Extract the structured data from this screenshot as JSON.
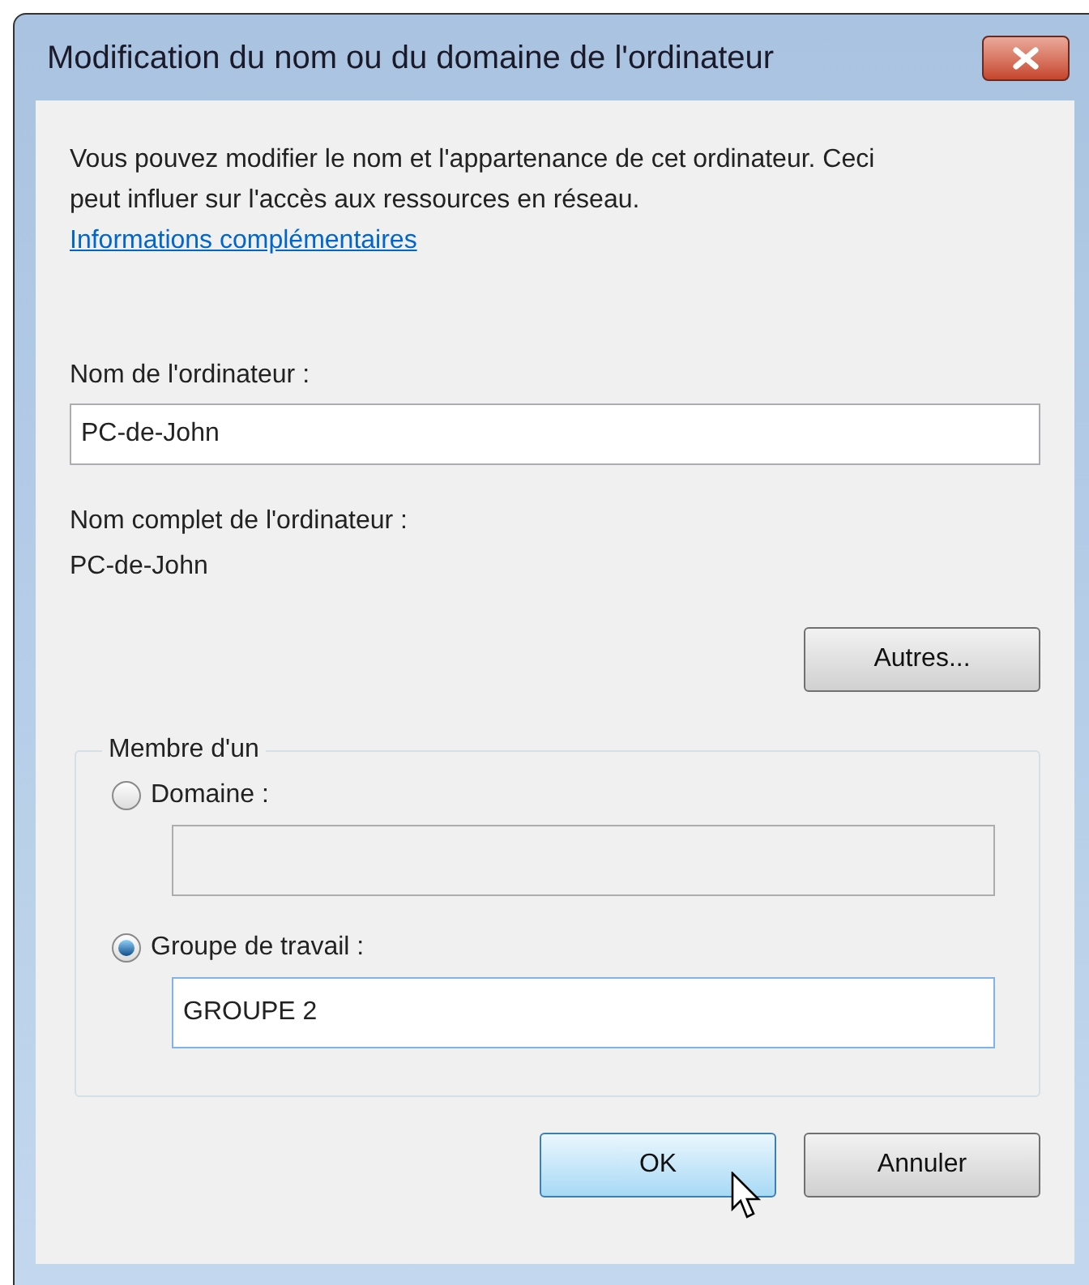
{
  "window": {
    "title": "Modification du nom ou du domaine de l'ordinateur"
  },
  "intro": {
    "text": "Vous pouvez modifier le nom et l'appartenance de cet ordinateur. Ceci peut influer sur l'accès aux ressources en réseau.",
    "link": "Informations complémentaires"
  },
  "computer_name": {
    "label": "Nom de l'ordinateur :",
    "value": "PC-de-John"
  },
  "full_name": {
    "label": "Nom complet de l'ordinateur :",
    "value": "PC-de-John"
  },
  "more_button": "Autres...",
  "member_of": {
    "legend": "Membre d'un",
    "options": [
      {
        "label": "Domaine :",
        "selected": false
      },
      {
        "label": "Groupe de travail :",
        "selected": true,
        "value": "GROUPE 2"
      }
    ]
  },
  "buttons": [
    {
      "label": "OK",
      "hovered": true
    },
    {
      "label": "Annuler",
      "hovered": false
    }
  ]
}
